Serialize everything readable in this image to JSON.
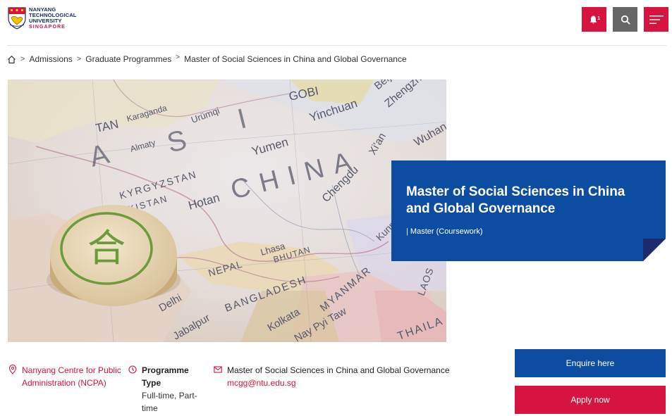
{
  "header": {
    "logo": {
      "line1": "NANYANG",
      "line2": "TECHNOLOGICAL",
      "line3": "UNIVERSITY",
      "line4": "SINGAPORE"
    },
    "icons": {
      "bell": "bell-icon",
      "search": "search-icon",
      "menu": "menu-icon"
    },
    "notification_count": "1",
    "colors": {
      "accent_red": "#d71440",
      "brand_blue": "#0c4da2",
      "grey": "#666666"
    }
  },
  "breadcrumb": {
    "home_icon": "home-icon",
    "items": [
      "Admissions",
      "Graduate Programmes",
      "Master of Social Sciences in China and Global Governance"
    ],
    "separator": ">"
  },
  "hero": {
    "title": "Master of Social Sciences in China and Global Governance",
    "subtitle": "| Master (Coursework)",
    "image": {
      "map_labels": [
        "A",
        "S",
        "I",
        "CHINA",
        "GOBI",
        "TAN",
        "Urümqi",
        "Karaganda",
        "KYRGYZSTAN",
        "Almaty",
        "TAJIKISTAN",
        "Yumen",
        "Yinchuan",
        "Zhengzhou",
        "Beijing",
        "Xi'an",
        "Wuhan",
        "Hotan",
        "Chengdu",
        "Kunming",
        "Lhasa",
        "NEPAL",
        "BHUTAN",
        "BANGLADESH",
        "MYANMAR",
        "LAOS",
        "THAILA",
        "Delhi",
        "Jabalpur",
        "Kolkata",
        "Nay Pyi Taw"
      ],
      "chess_piece_character": "合"
    }
  },
  "info": {
    "location": {
      "icon": "location-pin-icon",
      "text": "Nanyang Centre for Public Administration (NCPA)"
    },
    "programme_type": {
      "icon": "clock-icon",
      "label": "Programme Type",
      "value": "Full-time, Part-time"
    },
    "contact": {
      "icon": "mail-icon",
      "label": "Master of Social Sciences in China and Global Governance",
      "email": "mcgg@ntu.edu.sg"
    }
  },
  "actions": {
    "enquire": "Enquire here",
    "apply": "Apply now"
  }
}
